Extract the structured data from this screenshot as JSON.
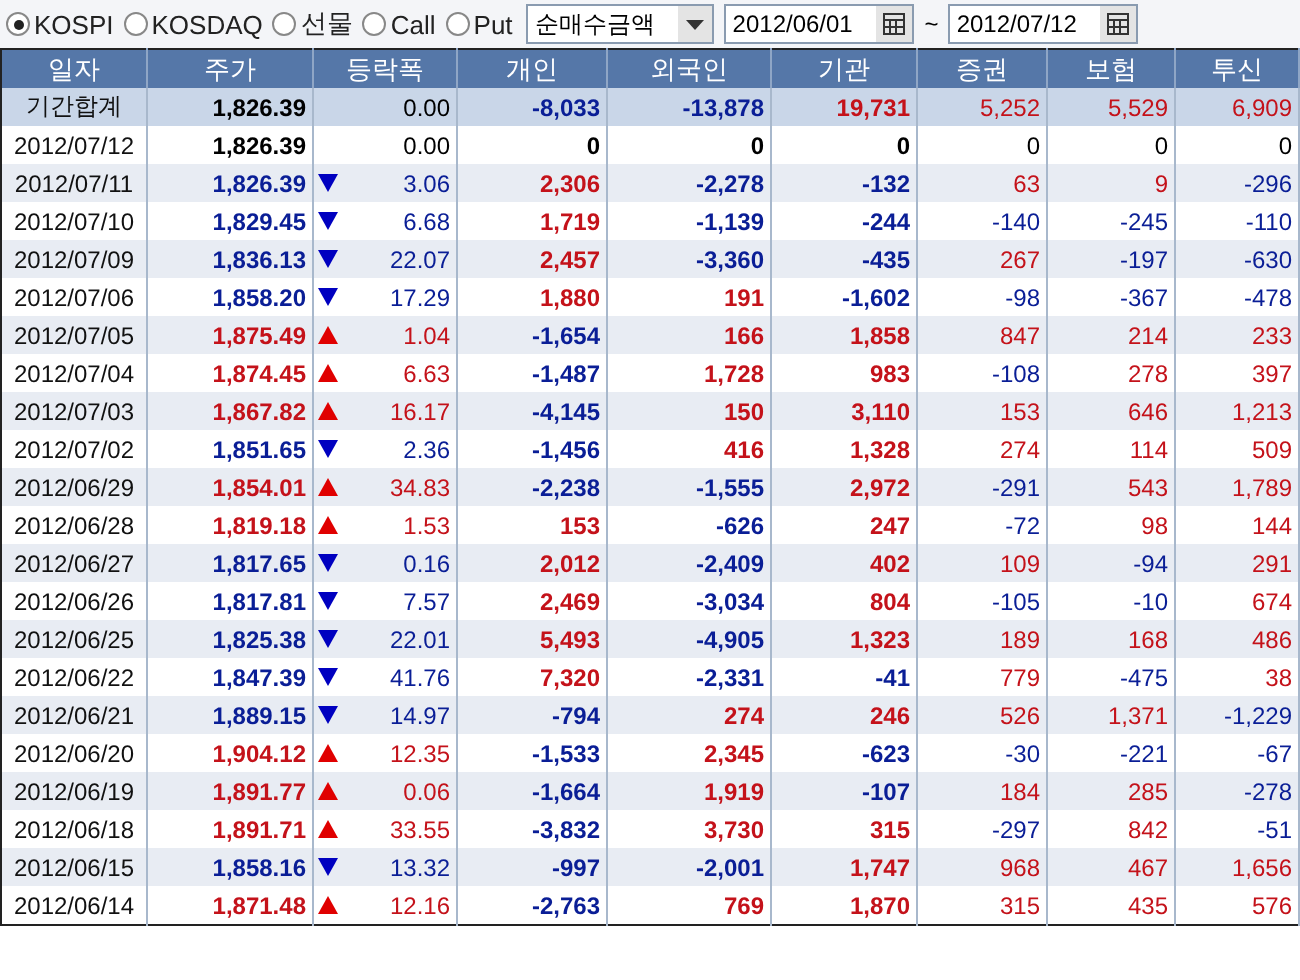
{
  "toolbar": {
    "markets": [
      {
        "label": "KOSPI",
        "selected": true
      },
      {
        "label": "KOSDAQ",
        "selected": false
      },
      {
        "label": "선물",
        "selected": false
      },
      {
        "label": "Call",
        "selected": false
      },
      {
        "label": "Put",
        "selected": false
      }
    ],
    "measure": {
      "value": "순매수금액"
    },
    "date_from": {
      "value": "2012/06/01"
    },
    "separator": "~",
    "date_to": {
      "value": "2012/07/12"
    }
  },
  "table": {
    "columns": [
      "일자",
      "주가",
      "등락폭",
      "개인",
      "외국인",
      "기관",
      "증권",
      "보험",
      "투신"
    ],
    "rows": [
      {
        "kind": "summary",
        "cells": [
          {
            "kind": "label",
            "text": "기간합계"
          },
          {
            "kind": "bold",
            "text": "1,826.39",
            "color": "#000000"
          },
          {
            "kind": "plain",
            "text": "0.00",
            "color": "#000000"
          },
          {
            "kind": "bold",
            "text": "-8,033",
            "color": "#0a1e96"
          },
          {
            "kind": "bold",
            "text": "-13,878",
            "color": "#0a1e96"
          },
          {
            "kind": "bold",
            "text": "19,731",
            "color": "#c4121a"
          },
          {
            "kind": "plain",
            "text": "5,252",
            "color": "#c4121a"
          },
          {
            "kind": "plain",
            "text": "5,529",
            "color": "#c4121a"
          },
          {
            "kind": "plain",
            "text": "6,909",
            "color": "#c4121a"
          }
        ]
      },
      {
        "kind": "day",
        "cells": [
          {
            "kind": "label",
            "text": "2012/07/12"
          },
          {
            "kind": "bold",
            "text": "1,826.39",
            "color": "#000000"
          },
          {
            "kind": "plain",
            "text": "0.00",
            "color": "#000000"
          },
          {
            "kind": "bold",
            "text": "0",
            "color": "#000000"
          },
          {
            "kind": "bold",
            "text": "0",
            "color": "#000000"
          },
          {
            "kind": "bold",
            "text": "0",
            "color": "#000000"
          },
          {
            "kind": "plain",
            "text": "0",
            "color": "#000000"
          },
          {
            "kind": "plain",
            "text": "0",
            "color": "#000000"
          },
          {
            "kind": "plain",
            "text": "0",
            "color": "#000000"
          }
        ]
      },
      {
        "kind": "day",
        "cells": [
          {
            "kind": "label",
            "text": "2012/07/11"
          },
          {
            "kind": "bold",
            "text": "1,826.39",
            "color": "#0a1e96"
          },
          {
            "kind": "fall",
            "text": "3.06",
            "color": "#0a1e96"
          },
          {
            "kind": "bold",
            "text": "2,306",
            "color": "#c4121a"
          },
          {
            "kind": "bold",
            "text": "-2,278",
            "color": "#0a1e96"
          },
          {
            "kind": "bold",
            "text": "-132",
            "color": "#0a1e96"
          },
          {
            "kind": "plain",
            "text": "63",
            "color": "#c4121a"
          },
          {
            "kind": "plain",
            "text": "9",
            "color": "#c4121a"
          },
          {
            "kind": "plain",
            "text": "-296",
            "color": "#0a1e96"
          }
        ]
      },
      {
        "kind": "day",
        "cells": [
          {
            "kind": "label",
            "text": "2012/07/10"
          },
          {
            "kind": "bold",
            "text": "1,829.45",
            "color": "#0a1e96"
          },
          {
            "kind": "fall",
            "text": "6.68",
            "color": "#0a1e96"
          },
          {
            "kind": "bold",
            "text": "1,719",
            "color": "#c4121a"
          },
          {
            "kind": "bold",
            "text": "-1,139",
            "color": "#0a1e96"
          },
          {
            "kind": "bold",
            "text": "-244",
            "color": "#0a1e96"
          },
          {
            "kind": "plain",
            "text": "-140",
            "color": "#0a1e96"
          },
          {
            "kind": "plain",
            "text": "-245",
            "color": "#0a1e96"
          },
          {
            "kind": "plain",
            "text": "-110",
            "color": "#0a1e96"
          }
        ]
      },
      {
        "kind": "day",
        "cells": [
          {
            "kind": "label",
            "text": "2012/07/09"
          },
          {
            "kind": "bold",
            "text": "1,836.13",
            "color": "#0a1e96"
          },
          {
            "kind": "fall",
            "text": "22.07",
            "color": "#0a1e96"
          },
          {
            "kind": "bold",
            "text": "2,457",
            "color": "#c4121a"
          },
          {
            "kind": "bold",
            "text": "-3,360",
            "color": "#0a1e96"
          },
          {
            "kind": "bold",
            "text": "-435",
            "color": "#0a1e96"
          },
          {
            "kind": "plain",
            "text": "267",
            "color": "#c4121a"
          },
          {
            "kind": "plain",
            "text": "-197",
            "color": "#0a1e96"
          },
          {
            "kind": "plain",
            "text": "-630",
            "color": "#0a1e96"
          }
        ]
      },
      {
        "kind": "day",
        "cells": [
          {
            "kind": "label",
            "text": "2012/07/06"
          },
          {
            "kind": "bold",
            "text": "1,858.20",
            "color": "#0a1e96"
          },
          {
            "kind": "fall",
            "text": "17.29",
            "color": "#0a1e96"
          },
          {
            "kind": "bold",
            "text": "1,880",
            "color": "#c4121a"
          },
          {
            "kind": "bold",
            "text": "191",
            "color": "#c4121a"
          },
          {
            "kind": "bold",
            "text": "-1,602",
            "color": "#0a1e96"
          },
          {
            "kind": "plain",
            "text": "-98",
            "color": "#0a1e96"
          },
          {
            "kind": "plain",
            "text": "-367",
            "color": "#0a1e96"
          },
          {
            "kind": "plain",
            "text": "-478",
            "color": "#0a1e96"
          }
        ]
      },
      {
        "kind": "day",
        "cells": [
          {
            "kind": "label",
            "text": "2012/07/05"
          },
          {
            "kind": "bold",
            "text": "1,875.49",
            "color": "#c4121a"
          },
          {
            "kind": "rise",
            "text": "1.04",
            "color": "#c4121a"
          },
          {
            "kind": "bold",
            "text": "-1,654",
            "color": "#0a1e96"
          },
          {
            "kind": "bold",
            "text": "166",
            "color": "#c4121a"
          },
          {
            "kind": "bold",
            "text": "1,858",
            "color": "#c4121a"
          },
          {
            "kind": "plain",
            "text": "847",
            "color": "#c4121a"
          },
          {
            "kind": "plain",
            "text": "214",
            "color": "#c4121a"
          },
          {
            "kind": "plain",
            "text": "233",
            "color": "#c4121a"
          }
        ]
      },
      {
        "kind": "day",
        "cells": [
          {
            "kind": "label",
            "text": "2012/07/04"
          },
          {
            "kind": "bold",
            "text": "1,874.45",
            "color": "#c4121a"
          },
          {
            "kind": "rise",
            "text": "6.63",
            "color": "#c4121a"
          },
          {
            "kind": "bold",
            "text": "-1,487",
            "color": "#0a1e96"
          },
          {
            "kind": "bold",
            "text": "1,728",
            "color": "#c4121a"
          },
          {
            "kind": "bold",
            "text": "983",
            "color": "#c4121a"
          },
          {
            "kind": "plain",
            "text": "-108",
            "color": "#0a1e96"
          },
          {
            "kind": "plain",
            "text": "278",
            "color": "#c4121a"
          },
          {
            "kind": "plain",
            "text": "397",
            "color": "#c4121a"
          }
        ]
      },
      {
        "kind": "day",
        "cells": [
          {
            "kind": "label",
            "text": "2012/07/03"
          },
          {
            "kind": "bold",
            "text": "1,867.82",
            "color": "#c4121a"
          },
          {
            "kind": "rise",
            "text": "16.17",
            "color": "#c4121a"
          },
          {
            "kind": "bold",
            "text": "-4,145",
            "color": "#0a1e96"
          },
          {
            "kind": "bold",
            "text": "150",
            "color": "#c4121a"
          },
          {
            "kind": "bold",
            "text": "3,110",
            "color": "#c4121a"
          },
          {
            "kind": "plain",
            "text": "153",
            "color": "#c4121a"
          },
          {
            "kind": "plain",
            "text": "646",
            "color": "#c4121a"
          },
          {
            "kind": "plain",
            "text": "1,213",
            "color": "#c4121a"
          }
        ]
      },
      {
        "kind": "day",
        "cells": [
          {
            "kind": "label",
            "text": "2012/07/02"
          },
          {
            "kind": "bold",
            "text": "1,851.65",
            "color": "#0a1e96"
          },
          {
            "kind": "fall",
            "text": "2.36",
            "color": "#0a1e96"
          },
          {
            "kind": "bold",
            "text": "-1,456",
            "color": "#0a1e96"
          },
          {
            "kind": "bold",
            "text": "416",
            "color": "#c4121a"
          },
          {
            "kind": "bold",
            "text": "1,328",
            "color": "#c4121a"
          },
          {
            "kind": "plain",
            "text": "274",
            "color": "#c4121a"
          },
          {
            "kind": "plain",
            "text": "114",
            "color": "#c4121a"
          },
          {
            "kind": "plain",
            "text": "509",
            "color": "#c4121a"
          }
        ]
      },
      {
        "kind": "day",
        "cells": [
          {
            "kind": "label",
            "text": "2012/06/29"
          },
          {
            "kind": "bold",
            "text": "1,854.01",
            "color": "#c4121a"
          },
          {
            "kind": "rise",
            "text": "34.83",
            "color": "#c4121a"
          },
          {
            "kind": "bold",
            "text": "-2,238",
            "color": "#0a1e96"
          },
          {
            "kind": "bold",
            "text": "-1,555",
            "color": "#0a1e96"
          },
          {
            "kind": "bold",
            "text": "2,972",
            "color": "#c4121a"
          },
          {
            "kind": "plain",
            "text": "-291",
            "color": "#0a1e96"
          },
          {
            "kind": "plain",
            "text": "543",
            "color": "#c4121a"
          },
          {
            "kind": "plain",
            "text": "1,789",
            "color": "#c4121a"
          }
        ]
      },
      {
        "kind": "day",
        "cells": [
          {
            "kind": "label",
            "text": "2012/06/28"
          },
          {
            "kind": "bold",
            "text": "1,819.18",
            "color": "#c4121a"
          },
          {
            "kind": "rise",
            "text": "1.53",
            "color": "#c4121a"
          },
          {
            "kind": "bold",
            "text": "153",
            "color": "#c4121a"
          },
          {
            "kind": "bold",
            "text": "-626",
            "color": "#0a1e96"
          },
          {
            "kind": "bold",
            "text": "247",
            "color": "#c4121a"
          },
          {
            "kind": "plain",
            "text": "-72",
            "color": "#0a1e96"
          },
          {
            "kind": "plain",
            "text": "98",
            "color": "#c4121a"
          },
          {
            "kind": "plain",
            "text": "144",
            "color": "#c4121a"
          }
        ]
      },
      {
        "kind": "day",
        "cells": [
          {
            "kind": "label",
            "text": "2012/06/27"
          },
          {
            "kind": "bold",
            "text": "1,817.65",
            "color": "#0a1e96"
          },
          {
            "kind": "fall",
            "text": "0.16",
            "color": "#0a1e96"
          },
          {
            "kind": "bold",
            "text": "2,012",
            "color": "#c4121a"
          },
          {
            "kind": "bold",
            "text": "-2,409",
            "color": "#0a1e96"
          },
          {
            "kind": "bold",
            "text": "402",
            "color": "#c4121a"
          },
          {
            "kind": "plain",
            "text": "109",
            "color": "#c4121a"
          },
          {
            "kind": "plain",
            "text": "-94",
            "color": "#0a1e96"
          },
          {
            "kind": "plain",
            "text": "291",
            "color": "#c4121a"
          }
        ]
      },
      {
        "kind": "day",
        "cells": [
          {
            "kind": "label",
            "text": "2012/06/26"
          },
          {
            "kind": "bold",
            "text": "1,817.81",
            "color": "#0a1e96"
          },
          {
            "kind": "fall",
            "text": "7.57",
            "color": "#0a1e96"
          },
          {
            "kind": "bold",
            "text": "2,469",
            "color": "#c4121a"
          },
          {
            "kind": "bold",
            "text": "-3,034",
            "color": "#0a1e96"
          },
          {
            "kind": "bold",
            "text": "804",
            "color": "#c4121a"
          },
          {
            "kind": "plain",
            "text": "-105",
            "color": "#0a1e96"
          },
          {
            "kind": "plain",
            "text": "-10",
            "color": "#0a1e96"
          },
          {
            "kind": "plain",
            "text": "674",
            "color": "#c4121a"
          }
        ]
      },
      {
        "kind": "day",
        "cells": [
          {
            "kind": "label",
            "text": "2012/06/25"
          },
          {
            "kind": "bold",
            "text": "1,825.38",
            "color": "#0a1e96"
          },
          {
            "kind": "fall",
            "text": "22.01",
            "color": "#0a1e96"
          },
          {
            "kind": "bold",
            "text": "5,493",
            "color": "#c4121a"
          },
          {
            "kind": "bold",
            "text": "-4,905",
            "color": "#0a1e96"
          },
          {
            "kind": "bold",
            "text": "1,323",
            "color": "#c4121a"
          },
          {
            "kind": "plain",
            "text": "189",
            "color": "#c4121a"
          },
          {
            "kind": "plain",
            "text": "168",
            "color": "#c4121a"
          },
          {
            "kind": "plain",
            "text": "486",
            "color": "#c4121a"
          }
        ]
      },
      {
        "kind": "day",
        "cells": [
          {
            "kind": "label",
            "text": "2012/06/22"
          },
          {
            "kind": "bold",
            "text": "1,847.39",
            "color": "#0a1e96"
          },
          {
            "kind": "fall",
            "text": "41.76",
            "color": "#0a1e96"
          },
          {
            "kind": "bold",
            "text": "7,320",
            "color": "#c4121a"
          },
          {
            "kind": "bold",
            "text": "-2,331",
            "color": "#0a1e96"
          },
          {
            "kind": "bold",
            "text": "-41",
            "color": "#0a1e96"
          },
          {
            "kind": "plain",
            "text": "779",
            "color": "#c4121a"
          },
          {
            "kind": "plain",
            "text": "-475",
            "color": "#0a1e96"
          },
          {
            "kind": "plain",
            "text": "38",
            "color": "#c4121a"
          }
        ]
      },
      {
        "kind": "day",
        "cells": [
          {
            "kind": "label",
            "text": "2012/06/21"
          },
          {
            "kind": "bold",
            "text": "1,889.15",
            "color": "#0a1e96"
          },
          {
            "kind": "fall",
            "text": "14.97",
            "color": "#0a1e96"
          },
          {
            "kind": "bold",
            "text": "-794",
            "color": "#0a1e96"
          },
          {
            "kind": "bold",
            "text": "274",
            "color": "#c4121a"
          },
          {
            "kind": "bold",
            "text": "246",
            "color": "#c4121a"
          },
          {
            "kind": "plain",
            "text": "526",
            "color": "#c4121a"
          },
          {
            "kind": "plain",
            "text": "1,371",
            "color": "#c4121a"
          },
          {
            "kind": "plain",
            "text": "-1,229",
            "color": "#0a1e96"
          }
        ]
      },
      {
        "kind": "day",
        "cells": [
          {
            "kind": "label",
            "text": "2012/06/20"
          },
          {
            "kind": "bold",
            "text": "1,904.12",
            "color": "#c4121a"
          },
          {
            "kind": "rise",
            "text": "12.35",
            "color": "#c4121a"
          },
          {
            "kind": "bold",
            "text": "-1,533",
            "color": "#0a1e96"
          },
          {
            "kind": "bold",
            "text": "2,345",
            "color": "#c4121a"
          },
          {
            "kind": "bold",
            "text": "-623",
            "color": "#0a1e96"
          },
          {
            "kind": "plain",
            "text": "-30",
            "color": "#0a1e96"
          },
          {
            "kind": "plain",
            "text": "-221",
            "color": "#0a1e96"
          },
          {
            "kind": "plain",
            "text": "-67",
            "color": "#0a1e96"
          }
        ]
      },
      {
        "kind": "day",
        "cells": [
          {
            "kind": "label",
            "text": "2012/06/19"
          },
          {
            "kind": "bold",
            "text": "1,891.77",
            "color": "#c4121a"
          },
          {
            "kind": "rise",
            "text": "0.06",
            "color": "#c4121a"
          },
          {
            "kind": "bold",
            "text": "-1,664",
            "color": "#0a1e96"
          },
          {
            "kind": "bold",
            "text": "1,919",
            "color": "#c4121a"
          },
          {
            "kind": "bold",
            "text": "-107",
            "color": "#0a1e96"
          },
          {
            "kind": "plain",
            "text": "184",
            "color": "#c4121a"
          },
          {
            "kind": "plain",
            "text": "285",
            "color": "#c4121a"
          },
          {
            "kind": "plain",
            "text": "-278",
            "color": "#0a1e96"
          }
        ]
      },
      {
        "kind": "day",
        "cells": [
          {
            "kind": "label",
            "text": "2012/06/18"
          },
          {
            "kind": "bold",
            "text": "1,891.71",
            "color": "#c4121a"
          },
          {
            "kind": "rise",
            "text": "33.55",
            "color": "#c4121a"
          },
          {
            "kind": "bold",
            "text": "-3,832",
            "color": "#0a1e96"
          },
          {
            "kind": "bold",
            "text": "3,730",
            "color": "#c4121a"
          },
          {
            "kind": "bold",
            "text": "315",
            "color": "#c4121a"
          },
          {
            "kind": "plain",
            "text": "-297",
            "color": "#0a1e96"
          },
          {
            "kind": "plain",
            "text": "842",
            "color": "#c4121a"
          },
          {
            "kind": "plain",
            "text": "-51",
            "color": "#0a1e96"
          }
        ]
      },
      {
        "kind": "day",
        "cells": [
          {
            "kind": "label",
            "text": "2012/06/15"
          },
          {
            "kind": "bold",
            "text": "1,858.16",
            "color": "#0a1e96"
          },
          {
            "kind": "fall",
            "text": "13.32",
            "color": "#0a1e96"
          },
          {
            "kind": "bold",
            "text": "-997",
            "color": "#0a1e96"
          },
          {
            "kind": "bold",
            "text": "-2,001",
            "color": "#0a1e96"
          },
          {
            "kind": "bold",
            "text": "1,747",
            "color": "#c4121a"
          },
          {
            "kind": "plain",
            "text": "968",
            "color": "#c4121a"
          },
          {
            "kind": "plain",
            "text": "467",
            "color": "#c4121a"
          },
          {
            "kind": "plain",
            "text": "1,656",
            "color": "#c4121a"
          }
        ]
      },
      {
        "kind": "day",
        "cells": [
          {
            "kind": "label",
            "text": "2012/06/14"
          },
          {
            "kind": "bold",
            "text": "1,871.48",
            "color": "#c4121a"
          },
          {
            "kind": "rise",
            "text": "12.16",
            "color": "#c4121a"
          },
          {
            "kind": "bold",
            "text": "-2,763",
            "color": "#0a1e96"
          },
          {
            "kind": "bold",
            "text": "769",
            "color": "#c4121a"
          },
          {
            "kind": "bold",
            "text": "1,870",
            "color": "#c4121a"
          },
          {
            "kind": "plain",
            "text": "315",
            "color": "#c4121a"
          },
          {
            "kind": "plain",
            "text": "435",
            "color": "#c4121a"
          },
          {
            "kind": "plain",
            "text": "576",
            "color": "#c4121a"
          }
        ]
      }
    ]
  }
}
